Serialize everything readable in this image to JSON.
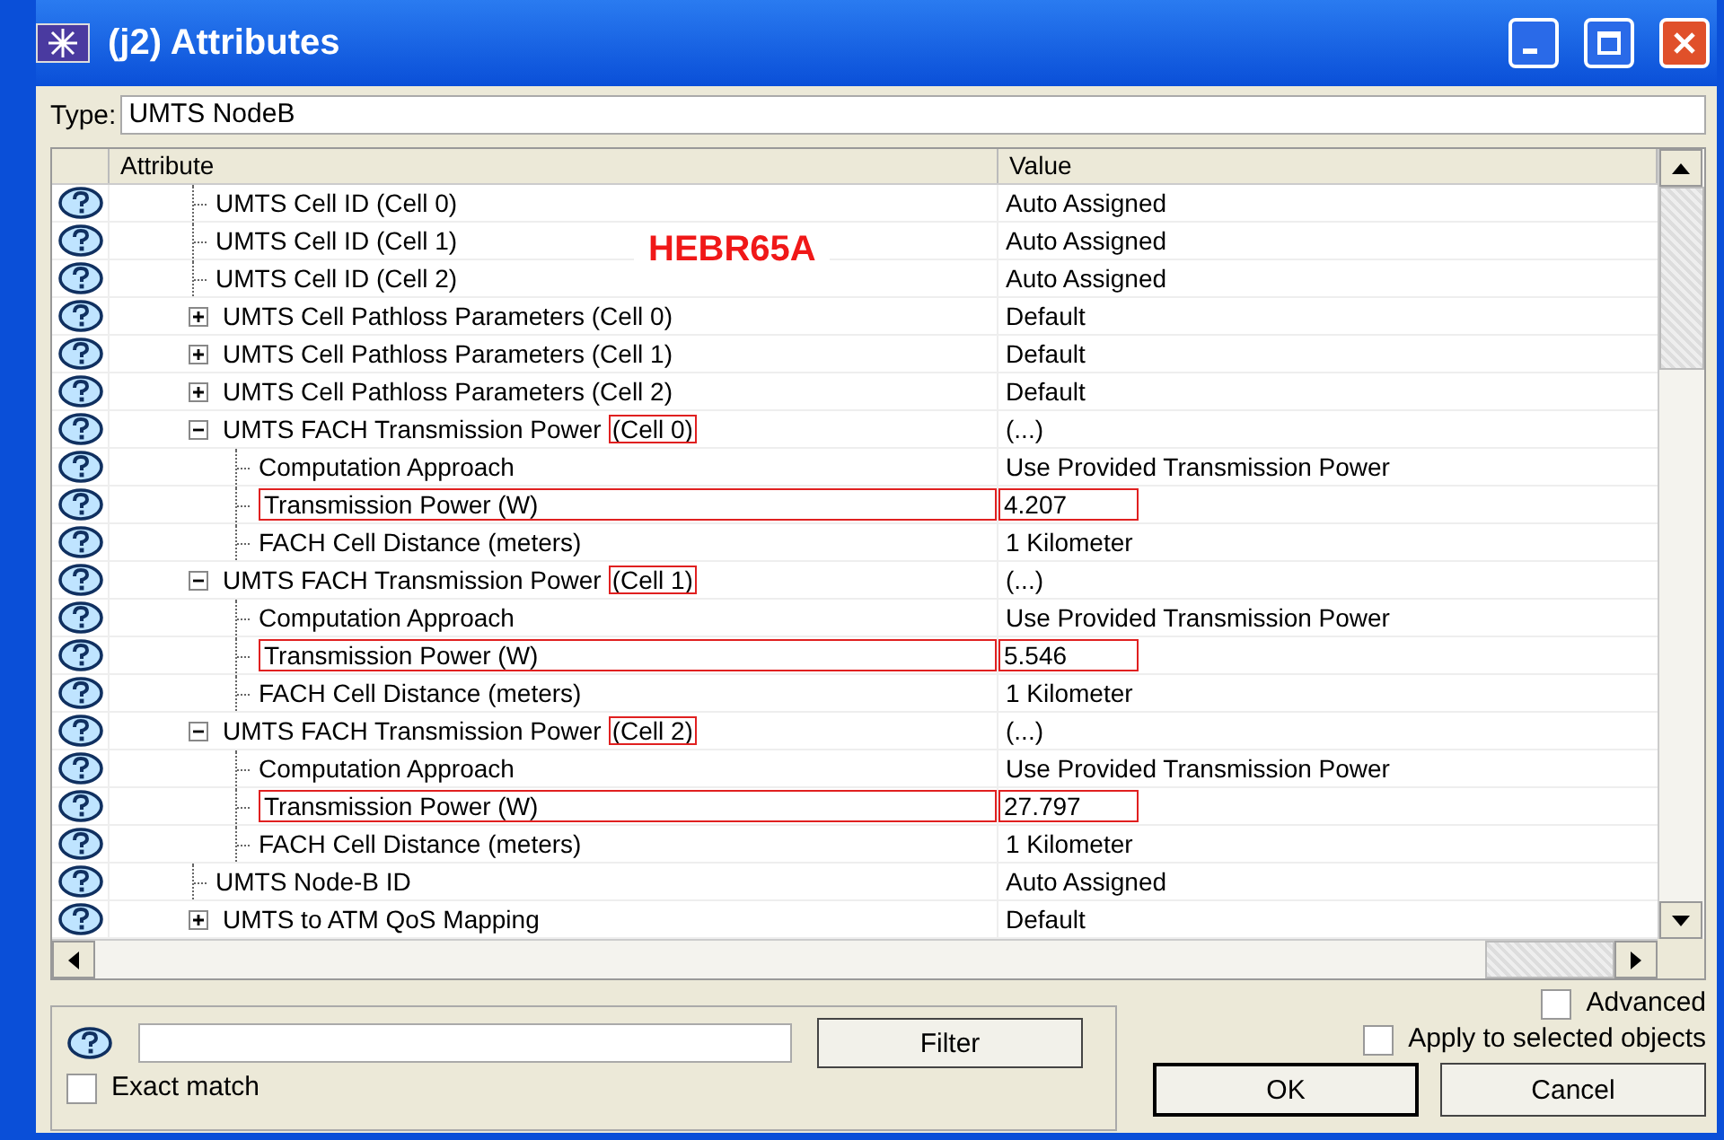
{
  "window": {
    "title": "(j2) Attributes"
  },
  "type_field": {
    "label": "Type:",
    "value": "UMTS NodeB"
  },
  "table": {
    "columns": [
      "Attribute",
      "Value"
    ],
    "rows": [
      {
        "kind": "leaf",
        "label": "UMTS Cell ID (Cell 0)",
        "value": "Auto Assigned"
      },
      {
        "kind": "leaf",
        "label": "UMTS Cell ID (Cell 1)",
        "value": "Auto Assigned"
      },
      {
        "kind": "leaf",
        "label": "UMTS Cell ID (Cell 2)",
        "value": "Auto Assigned"
      },
      {
        "kind": "group",
        "expanded": false,
        "label": "UMTS Cell Pathloss Parameters (Cell 0)",
        "value": "Default"
      },
      {
        "kind": "group",
        "expanded": false,
        "label": "UMTS Cell Pathloss Parameters (Cell 1)",
        "value": "Default"
      },
      {
        "kind": "group",
        "expanded": false,
        "label": "UMTS Cell Pathloss Parameters (Cell 2)",
        "value": "Default"
      },
      {
        "kind": "group",
        "expanded": true,
        "label": "UMTS FACH Transmission Power",
        "suffix": "(Cell 0)",
        "suffix_marked": true,
        "value": "(...)",
        "children": [
          {
            "kind": "leaf",
            "label": "Computation Approach",
            "value": "Use Provided Transmission Power",
            "marked": false
          },
          {
            "kind": "leaf",
            "label": "Transmission Power (W)",
            "value": "4.207",
            "marked": true
          },
          {
            "kind": "leaf",
            "label": "FACH Cell Distance (meters)",
            "value": "1 Kilometer",
            "marked": false
          }
        ]
      },
      {
        "kind": "group",
        "expanded": true,
        "label": "UMTS FACH Transmission Power",
        "suffix": "(Cell 1)",
        "suffix_marked": true,
        "value": "(...)",
        "children": [
          {
            "kind": "leaf",
            "label": "Computation Approach",
            "value": "Use Provided Transmission Power",
            "marked": false
          },
          {
            "kind": "leaf",
            "label": "Transmission Power (W)",
            "value": "5.546",
            "marked": true
          },
          {
            "kind": "leaf",
            "label": "FACH Cell Distance (meters)",
            "value": "1 Kilometer",
            "marked": false
          }
        ]
      },
      {
        "kind": "group",
        "expanded": true,
        "label": "UMTS FACH Transmission Power",
        "suffix": "(Cell 2)",
        "suffix_marked": true,
        "value": "(...)",
        "children": [
          {
            "kind": "leaf",
            "label": "Computation Approach",
            "value": "Use Provided Transmission Power",
            "marked": false
          },
          {
            "kind": "leaf",
            "label": "Transmission Power (W)",
            "value": "27.797",
            "marked": true
          },
          {
            "kind": "leaf",
            "label": "FACH Cell Distance (meters)",
            "value": "1 Kilometer",
            "marked": false
          }
        ]
      },
      {
        "kind": "leaf",
        "label": "UMTS Node-B ID",
        "value": "Auto Assigned"
      },
      {
        "kind": "group",
        "expanded": false,
        "label": "UMTS to ATM QoS Mapping",
        "value": "Default"
      }
    ]
  },
  "annotation": "HEBR65A",
  "filter": {
    "button": "Filter",
    "exact_match": {
      "label": "Exact match",
      "checked": false
    }
  },
  "advanced": {
    "label": "Advanced",
    "checked": false
  },
  "apply_selected": {
    "label": "Apply to selected objects",
    "checked": false
  },
  "buttons": [
    "OK",
    "Cancel"
  ]
}
